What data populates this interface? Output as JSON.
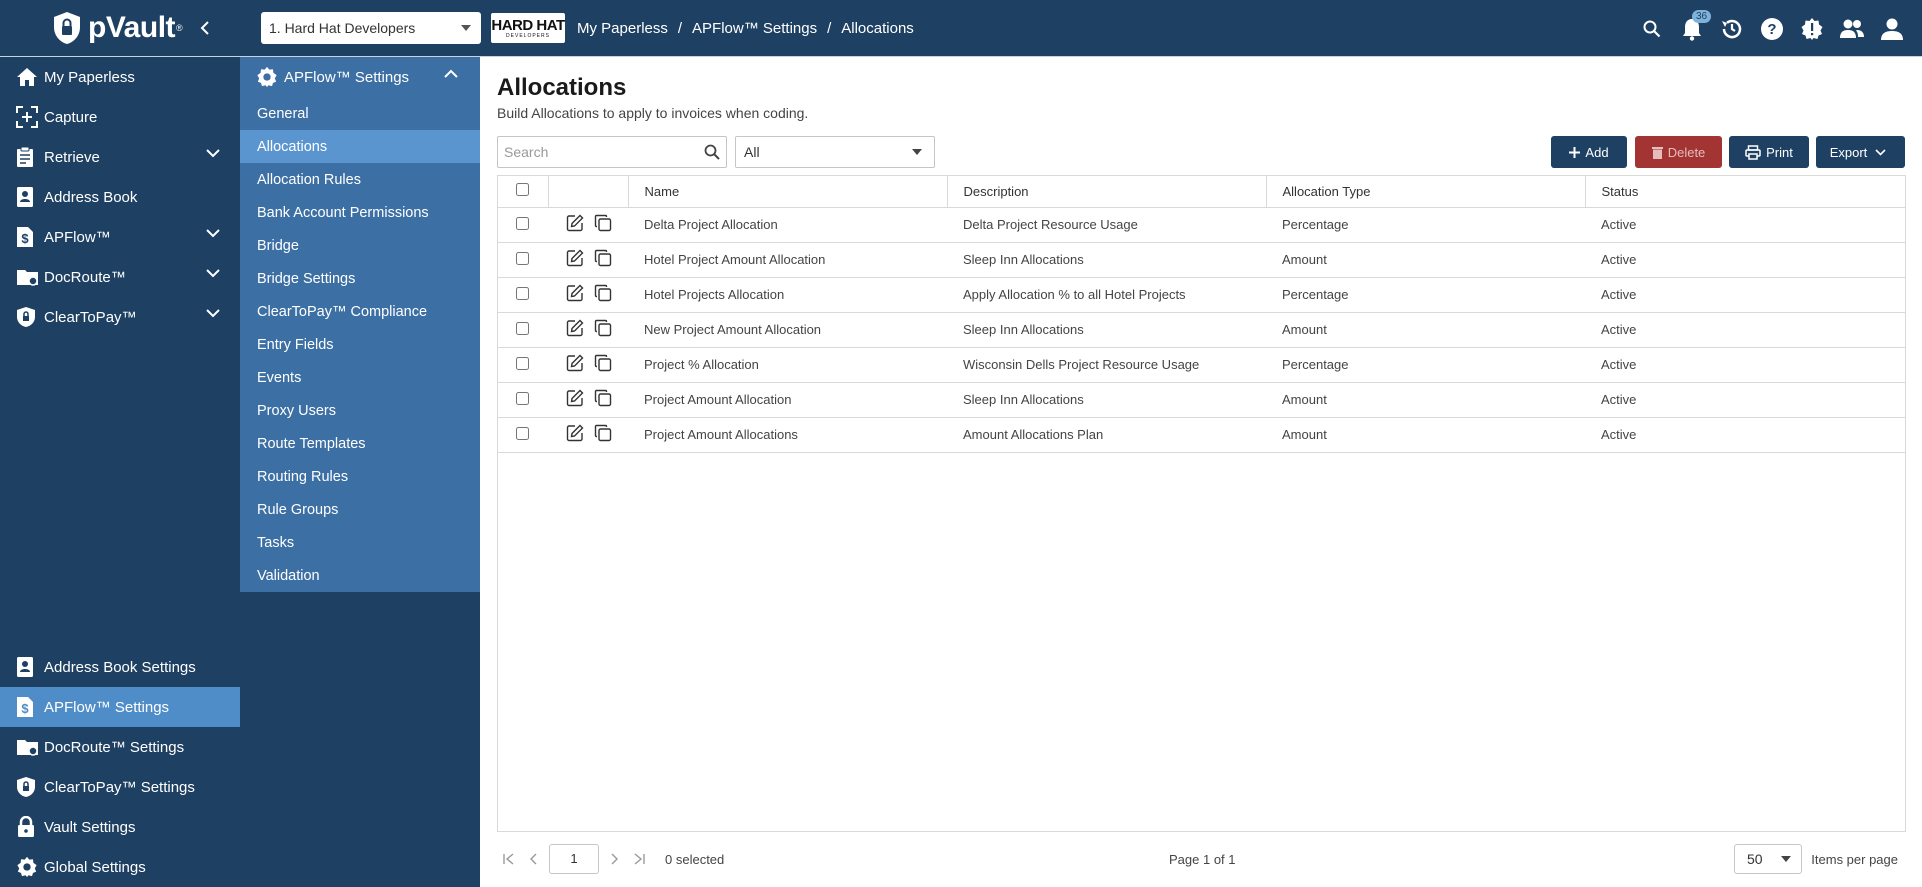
{
  "app": {
    "name": "pVault",
    "trademark": "®"
  },
  "header": {
    "company": "1. Hard Hat Developers",
    "company_logo_big": "HARD HAT",
    "company_logo_small": "DEVELOPERS",
    "breadcrumb": [
      "My Paperless",
      "APFlow™ Settings",
      "Allocations"
    ],
    "notifications_count": "36"
  },
  "sidebar": {
    "items": [
      {
        "label": "My Paperless",
        "icon": "home-icon"
      },
      {
        "label": "Capture",
        "icon": "capture-icon"
      },
      {
        "label": "Retrieve",
        "icon": "clipboard-icon",
        "expandable": true
      },
      {
        "label": "Address Book",
        "icon": "contact-book-icon"
      },
      {
        "label": "APFlow™",
        "icon": "dollar-doc-icon",
        "expandable": true
      },
      {
        "label": "DocRoute™",
        "icon": "folder-route-icon",
        "expandable": true
      },
      {
        "label": "ClearToPay™",
        "icon": "shield-lock-icon",
        "expandable": true
      }
    ],
    "bottom_items": [
      {
        "label": "Address Book Settings",
        "icon": "contact-book-icon"
      },
      {
        "label": "APFlow™ Settings",
        "icon": "dollar-doc-icon",
        "active": true
      },
      {
        "label": "DocRoute™ Settings",
        "icon": "folder-route-icon"
      },
      {
        "label": "ClearToPay™ Settings",
        "icon": "shield-lock-icon"
      },
      {
        "label": "Vault Settings",
        "icon": "lock-icon"
      },
      {
        "label": "Global Settings",
        "icon": "gear-icon"
      }
    ]
  },
  "subnav": {
    "header": "APFlow™ Settings",
    "items": [
      "General",
      "Allocations",
      "Allocation Rules",
      "Bank Account Permissions",
      "Bridge",
      "Bridge Settings",
      "ClearToPay™ Compliance",
      "Entry Fields",
      "Events",
      "Proxy Users",
      "Route Templates",
      "Routing Rules",
      "Rule Groups",
      "Tasks",
      "Validation"
    ],
    "active": "Allocations"
  },
  "main": {
    "title": "Allocations",
    "subtitle": "Build Allocations to apply to invoices when coding.",
    "search_placeholder": "Search",
    "filter_value": "All",
    "buttons": {
      "add": "Add",
      "delete": "Delete",
      "print": "Print",
      "export": "Export"
    },
    "columns": [
      "Name",
      "Description",
      "Allocation Type",
      "Status"
    ],
    "rows": [
      {
        "name": "Delta Project Allocation",
        "description": "Delta Project Resource Usage",
        "type": "Percentage",
        "status": "Active"
      },
      {
        "name": "Hotel Project Amount Allocation",
        "description": "Sleep Inn Allocations",
        "type": "Amount",
        "status": "Active"
      },
      {
        "name": "Hotel Projects Allocation",
        "description": "Apply Allocation % to all Hotel Projects",
        "type": "Percentage",
        "status": "Active"
      },
      {
        "name": "New Project Amount Allocation",
        "description": "Sleep Inn Allocations",
        "type": "Amount",
        "status": "Active"
      },
      {
        "name": "Project % Allocation",
        "description": "Wisconsin Dells Project Resource Usage",
        "type": "Percentage",
        "status": "Active"
      },
      {
        "name": "Project Amount Allocation",
        "description": "Sleep Inn Allocations",
        "type": "Amount",
        "status": "Active"
      },
      {
        "name": "Project Amount Allocations",
        "description": "Amount Allocations Plan",
        "type": "Amount",
        "status": "Active"
      }
    ]
  },
  "pager": {
    "page": "1",
    "selected": "0 selected",
    "page_of": "Page 1 of 1",
    "per_page": "50",
    "per_page_label": "Items per page"
  },
  "colors": {
    "navy": "#1e4063",
    "active": "#4f8dc9",
    "subnav": "#3c6fa4",
    "delete": "#a33434"
  }
}
